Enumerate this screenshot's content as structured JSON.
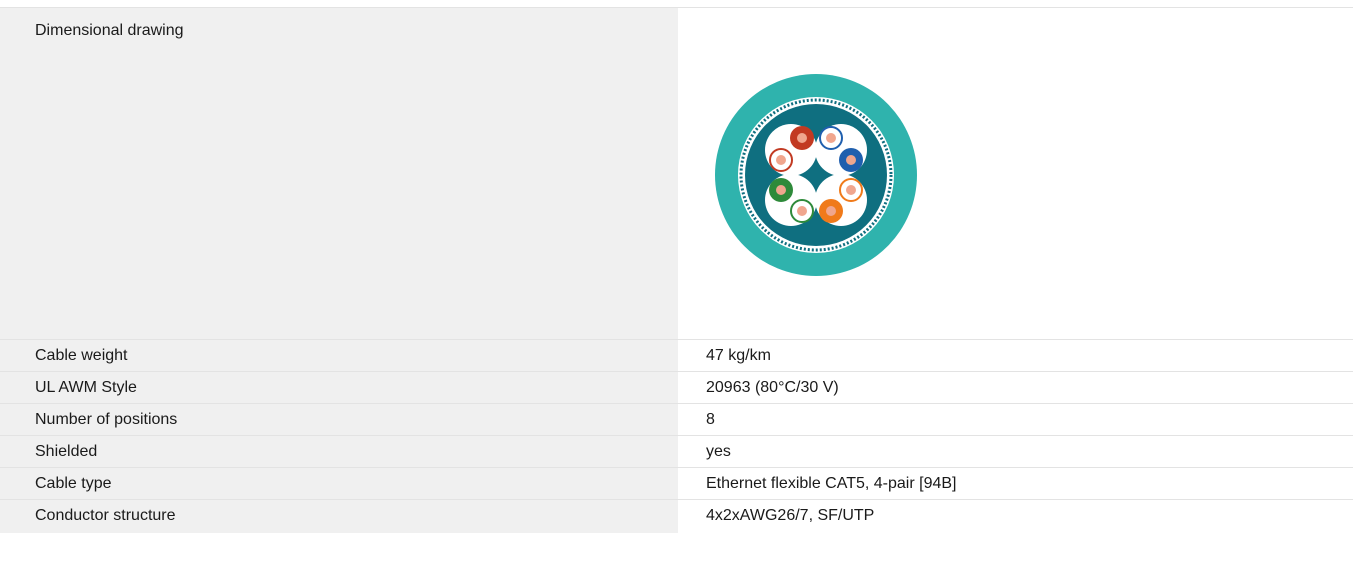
{
  "rows": [
    {
      "label": "Dimensional drawing",
      "value": ""
    },
    {
      "label": "Cable weight",
      "value": "47 kg/km"
    },
    {
      "label": "UL AWM Style",
      "value": "20963 (80°C/30 V)"
    },
    {
      "label": "Number of positions",
      "value": "8"
    },
    {
      "label": "Shielded",
      "value": "yes"
    },
    {
      "label": "Cable type",
      "value": "Ethernet flexible CAT5, 4-pair [94B]"
    },
    {
      "label": "Conductor structure",
      "value": "4x2xAWG26/7, SF/UTP"
    }
  ],
  "drawing": {
    "image": "cable-cross-section-image",
    "colors": {
      "jacket": "#2fb3ad",
      "inner": "#0f6f80",
      "pair_red": "#c23a22",
      "pair_blue": "#1f5fae",
      "pair_green": "#2e8a3a",
      "pair_orange": "#f07a1a",
      "copper": "#f0a68e"
    }
  }
}
